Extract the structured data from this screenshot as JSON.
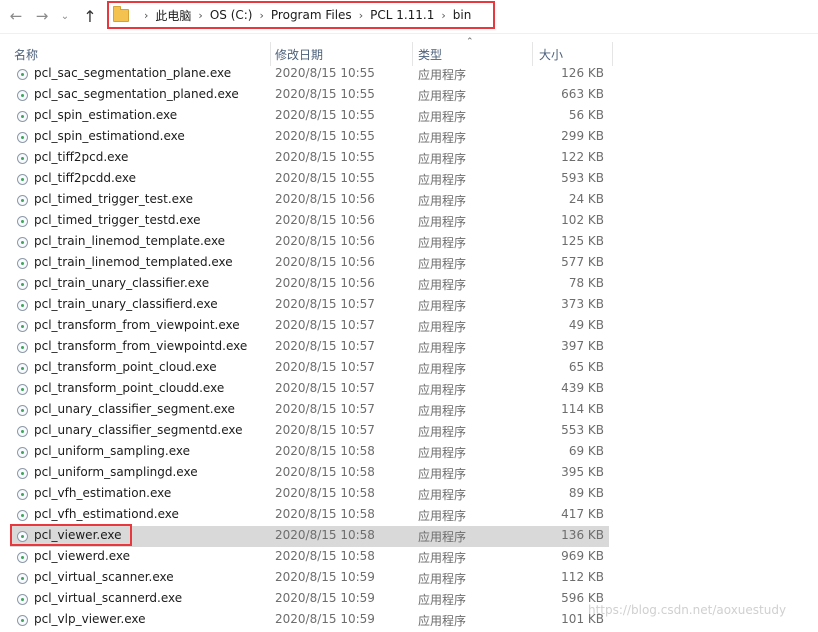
{
  "address_bar": {
    "breadcrumbs": [
      "此电脑",
      "OS (C:)",
      "Program Files",
      "PCL 1.11.1",
      "bin"
    ]
  },
  "columns": {
    "name": "名称",
    "date": "修改日期",
    "type": "类型",
    "size": "大小"
  },
  "files": [
    {
      "name": "pcl_sac_segmentation_plane.exe",
      "date": "2020/8/15 10:55",
      "type": "应用程序",
      "size": "126 KB"
    },
    {
      "name": "pcl_sac_segmentation_planed.exe",
      "date": "2020/8/15 10:55",
      "type": "应用程序",
      "size": "663 KB"
    },
    {
      "name": "pcl_spin_estimation.exe",
      "date": "2020/8/15 10:55",
      "type": "应用程序",
      "size": "56 KB"
    },
    {
      "name": "pcl_spin_estimationd.exe",
      "date": "2020/8/15 10:55",
      "type": "应用程序",
      "size": "299 KB"
    },
    {
      "name": "pcl_tiff2pcd.exe",
      "date": "2020/8/15 10:55",
      "type": "应用程序",
      "size": "122 KB"
    },
    {
      "name": "pcl_tiff2pcdd.exe",
      "date": "2020/8/15 10:55",
      "type": "应用程序",
      "size": "593 KB"
    },
    {
      "name": "pcl_timed_trigger_test.exe",
      "date": "2020/8/15 10:56",
      "type": "应用程序",
      "size": "24 KB"
    },
    {
      "name": "pcl_timed_trigger_testd.exe",
      "date": "2020/8/15 10:56",
      "type": "应用程序",
      "size": "102 KB"
    },
    {
      "name": "pcl_train_linemod_template.exe",
      "date": "2020/8/15 10:56",
      "type": "应用程序",
      "size": "125 KB"
    },
    {
      "name": "pcl_train_linemod_templated.exe",
      "date": "2020/8/15 10:56",
      "type": "应用程序",
      "size": "577 KB"
    },
    {
      "name": "pcl_train_unary_classifier.exe",
      "date": "2020/8/15 10:56",
      "type": "应用程序",
      "size": "78 KB"
    },
    {
      "name": "pcl_train_unary_classifierd.exe",
      "date": "2020/8/15 10:57",
      "type": "应用程序",
      "size": "373 KB"
    },
    {
      "name": "pcl_transform_from_viewpoint.exe",
      "date": "2020/8/15 10:57",
      "type": "应用程序",
      "size": "49 KB"
    },
    {
      "name": "pcl_transform_from_viewpointd.exe",
      "date": "2020/8/15 10:57",
      "type": "应用程序",
      "size": "397 KB"
    },
    {
      "name": "pcl_transform_point_cloud.exe",
      "date": "2020/8/15 10:57",
      "type": "应用程序",
      "size": "65 KB"
    },
    {
      "name": "pcl_transform_point_cloudd.exe",
      "date": "2020/8/15 10:57",
      "type": "应用程序",
      "size": "439 KB"
    },
    {
      "name": "pcl_unary_classifier_segment.exe",
      "date": "2020/8/15 10:57",
      "type": "应用程序",
      "size": "114 KB"
    },
    {
      "name": "pcl_unary_classifier_segmentd.exe",
      "date": "2020/8/15 10:57",
      "type": "应用程序",
      "size": "553 KB"
    },
    {
      "name": "pcl_uniform_sampling.exe",
      "date": "2020/8/15 10:58",
      "type": "应用程序",
      "size": "69 KB"
    },
    {
      "name": "pcl_uniform_samplingd.exe",
      "date": "2020/8/15 10:58",
      "type": "应用程序",
      "size": "395 KB"
    },
    {
      "name": "pcl_vfh_estimation.exe",
      "date": "2020/8/15 10:58",
      "type": "应用程序",
      "size": "89 KB"
    },
    {
      "name": "pcl_vfh_estimationd.exe",
      "date": "2020/8/15 10:58",
      "type": "应用程序",
      "size": "417 KB"
    },
    {
      "name": "pcl_viewer.exe",
      "date": "2020/8/15 10:58",
      "type": "应用程序",
      "size": "136 KB",
      "selected": true
    },
    {
      "name": "pcl_viewerd.exe",
      "date": "2020/8/15 10:58",
      "type": "应用程序",
      "size": "969 KB"
    },
    {
      "name": "pcl_virtual_scanner.exe",
      "date": "2020/8/15 10:59",
      "type": "应用程序",
      "size": "112 KB"
    },
    {
      "name": "pcl_virtual_scannerd.exe",
      "date": "2020/8/15 10:59",
      "type": "应用程序",
      "size": "596 KB"
    },
    {
      "name": "pcl_vlp_viewer.exe",
      "date": "2020/8/15 10:59",
      "type": "应用程序",
      "size": "101 KB"
    }
  ],
  "watermark": "https://blog.csdn.net/aoxuestudy"
}
